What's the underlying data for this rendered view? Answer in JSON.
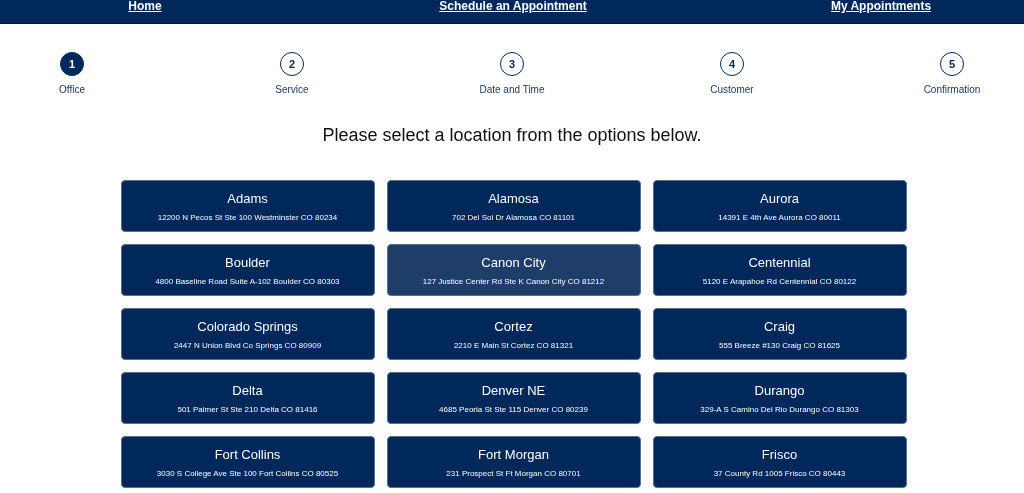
{
  "nav": [
    {
      "label": "Home"
    },
    {
      "label": "Schedule an Appointment"
    },
    {
      "label": "My Appointments"
    }
  ],
  "steps": [
    {
      "number": "1",
      "label": "Office",
      "selected": true
    },
    {
      "number": "2",
      "label": "Service",
      "selected": false
    },
    {
      "number": "3",
      "label": "Date and Time",
      "selected": false
    },
    {
      "number": "4",
      "label": "Customer",
      "selected": false
    },
    {
      "number": "5",
      "label": "Confirmation",
      "selected": false
    }
  ],
  "heading": "Please select a location from the options below.",
  "offices": [
    {
      "name": "Adams",
      "address": "12200 N Pecos St Ste 100 Westminster CO 80234",
      "highlighted": false
    },
    {
      "name": "Alamosa",
      "address": "702 Del Sol Dr Alamosa CO 81101",
      "highlighted": false
    },
    {
      "name": "Aurora",
      "address": "14391 E 4th Ave Aurora CO 80011",
      "highlighted": false
    },
    {
      "name": "Boulder",
      "address": "4800 Baseline Road Suite A-102 Boulder CO 80303",
      "highlighted": false
    },
    {
      "name": "Canon City",
      "address": "127 Justice Center Rd Ste K Canon City CO 81212",
      "highlighted": true
    },
    {
      "name": "Centennial",
      "address": "5120 E Arapahoe Rd Centennial CO 80122",
      "highlighted": false
    },
    {
      "name": "Colorado Springs",
      "address": "2447 N Union Blvd Co Springs CO 80909",
      "highlighted": false
    },
    {
      "name": "Cortez",
      "address": "2210 E Main St Cortez CO 81321",
      "highlighted": false
    },
    {
      "name": "Craig",
      "address": "555 Breeze #130 Craig CO 81625",
      "highlighted": false
    },
    {
      "name": "Delta",
      "address": "501 Palmer St Ste 210 Delta CO 81416",
      "highlighted": false
    },
    {
      "name": "Denver NE",
      "address": "4685 Peoria St Ste 115 Denver CO 80239",
      "highlighted": false
    },
    {
      "name": "Durango",
      "address": "329-A S Camino Del Rio Durango CO 81303",
      "highlighted": false
    },
    {
      "name": "Fort Collins",
      "address": "3030 S College Ave Ste 100 Fort Collins CO 80525",
      "highlighted": false
    },
    {
      "name": "Fort Morgan",
      "address": "231 Prospect St Ft Morgan CO 80701",
      "highlighted": false
    },
    {
      "name": "Frisco",
      "address": "37 County Rd 1005 Frisco CO 80443",
      "highlighted": false
    }
  ]
}
